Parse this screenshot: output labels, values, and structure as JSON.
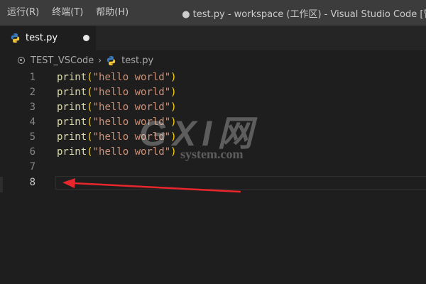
{
  "titlebar": {
    "menu": [
      "运行(R)",
      "终端(T)",
      "帮助(H)"
    ],
    "window_title": "● test.py - workspace (工作区) - Visual Studio Code [管理"
  },
  "tab": {
    "label": "test.py",
    "icon": "python-icon",
    "dirty": true
  },
  "breadcrumb": {
    "folder": "TEST_VSCode",
    "file": "test.py"
  },
  "editor": {
    "lines": [
      {
        "number": "1",
        "fn": "print",
        "open": "(",
        "str": "\"hello world\"",
        "close": ")"
      },
      {
        "number": "2",
        "fn": "print",
        "open": "(",
        "str": "\"hello world\"",
        "close": ")"
      },
      {
        "number": "3",
        "fn": "print",
        "open": "(",
        "str": "\"hello world\"",
        "close": ")"
      },
      {
        "number": "4",
        "fn": "print",
        "open": "(",
        "str": "\"hello world\"",
        "close": ")"
      },
      {
        "number": "5",
        "fn": "print",
        "open": "(",
        "str": "\"hello world\"",
        "close": ")"
      },
      {
        "number": "6",
        "fn": "print",
        "open": "(",
        "str": "\"hello world\"",
        "close": ")"
      },
      {
        "number": "7"
      },
      {
        "number": "8"
      }
    ],
    "current_line": "8"
  },
  "watermark": {
    "big": "GXI网",
    "small": "system.com"
  },
  "colors": {
    "function": "#dcdcaa",
    "string": "#ce9178",
    "bracket": "#ffd700",
    "annotation_arrow": "#e8262c"
  }
}
